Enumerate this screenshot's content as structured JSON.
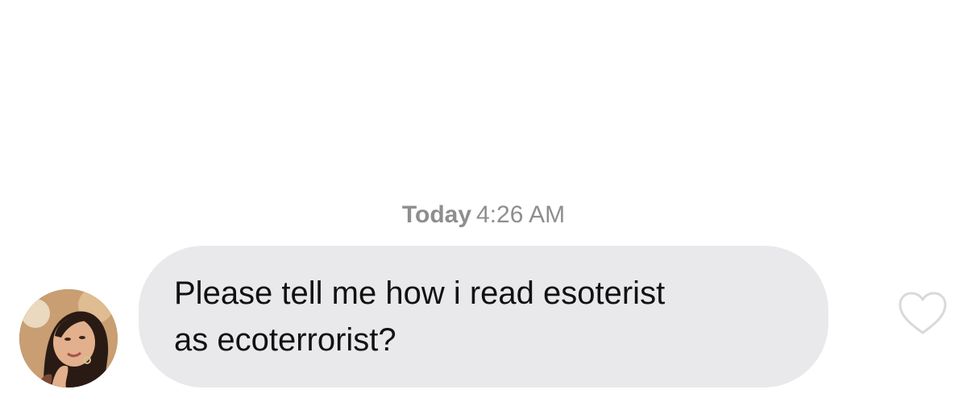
{
  "conversation": {
    "timestamp": {
      "day": "Today",
      "time": "4:26 AM"
    },
    "message": {
      "text": "Please tell me how i read esoterist\nas ecoterrorist?",
      "bubble_color": "#e9e9eb",
      "text_color": "#111111"
    },
    "sender_avatar": {
      "icon": "profile-photo"
    },
    "like_button": {
      "icon": "heart-outline-icon",
      "color": "#d9d9d9"
    }
  }
}
